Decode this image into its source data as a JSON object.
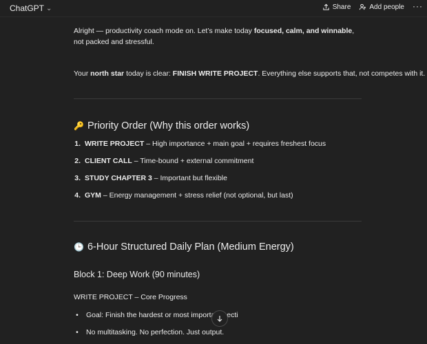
{
  "header": {
    "title": "ChatGPT",
    "share_label": "Share",
    "add_people_label": "Add people",
    "more_label": "···"
  },
  "message": {
    "intro_1": "Alright — productivity coach mode on. Let’s make today ",
    "intro_bold": "focused, calm, and winnable",
    "intro_2": ", not packed and stressful.",
    "north_1": "Your ",
    "north_bold": "north star",
    "north_2": " today is clear: ",
    "north_goal": "FINISH WRITE PROJECT",
    "north_3": ". Everything else supports that, not competes with it.",
    "priority_heading_icon": "🔑",
    "priority_heading": "Priority Order (Why this order works)",
    "priorities": [
      {
        "num": "1.",
        "task": "WRITE PROJECT",
        "reason": " – High importance + main goal + requires freshest focus"
      },
      {
        "num": "2.",
        "task": "CLIENT CALL",
        "reason": " – Time-bound + external commitment"
      },
      {
        "num": "3.",
        "task": "STUDY CHAPTER 3",
        "reason": " – Important but flexible"
      },
      {
        "num": "4.",
        "task": "GYM",
        "reason": " – Energy management + stress relief (not optional, but last)"
      }
    ],
    "plan_heading_icon": "🕒",
    "plan_heading": "6-Hour Structured Daily Plan (Medium Energy)",
    "block1_heading": "Block 1: Deep Work (90 minutes)",
    "block1_sub": "WRITE PROJECT – Core Progress",
    "block1_bullets": [
      "Goal: Finish the hardest or most important secti",
      "No multitasking. No perfection. Just output."
    ]
  },
  "icons": {
    "chevron": "chevron-down-icon",
    "share": "share-icon",
    "add_people": "add-person-icon",
    "scroll_down": "arrow-down-icon"
  }
}
